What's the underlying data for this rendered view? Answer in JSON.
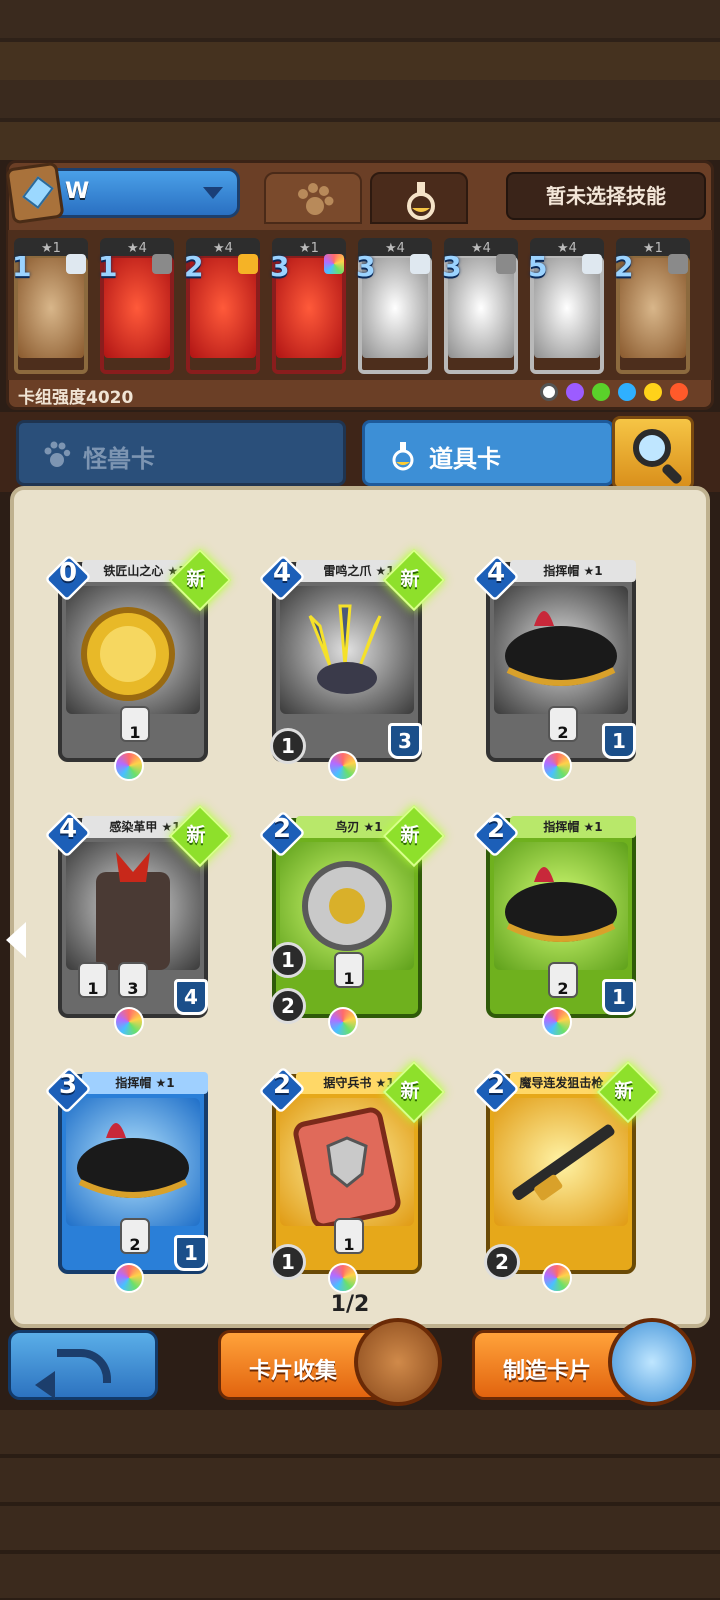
{
  "header": {
    "deck_name": "W",
    "skill_label": "暂未选择技能",
    "tabs": [
      "paw-icon",
      "flask-icon"
    ]
  },
  "deck": {
    "power_label": "卡组强度4020",
    "cards": [
      {
        "stars": "★1",
        "cost": "1",
        "style": "gold"
      },
      {
        "stars": "★4",
        "cost": "1",
        "style": "red"
      },
      {
        "stars": "★4",
        "cost": "2",
        "style": "red"
      },
      {
        "stars": "★1",
        "cost": "3",
        "style": "red"
      },
      {
        "stars": "★4",
        "cost": "3",
        "style": "gray"
      },
      {
        "stars": "★4",
        "cost": "3",
        "style": "gray"
      },
      {
        "stars": "★4",
        "cost": "5",
        "style": "gray"
      },
      {
        "stars": "★1",
        "cost": "2",
        "style": "gold"
      }
    ],
    "elements": [
      "white",
      "purple",
      "green",
      "blue",
      "yellow",
      "red"
    ]
  },
  "category_tabs": {
    "monster": "怪兽卡",
    "item": "道具卡"
  },
  "grid": {
    "new_label": "新",
    "cards": [
      {
        "name": "铁匠山之心 ★1",
        "cost": "0",
        "new": true,
        "color": "gray"
      },
      {
        "name": "雷鸣之爪 ★1",
        "cost": "4",
        "new": true,
        "color": "gray"
      },
      {
        "name": "指挥帽 ★1",
        "cost": "4",
        "new": false,
        "color": "gray"
      },
      {
        "name": "感染革甲 ★1",
        "cost": "4",
        "new": true,
        "color": "gray"
      },
      {
        "name": "鸟刃 ★1",
        "cost": "2",
        "new": true,
        "color": "green"
      },
      {
        "name": "指挥帽 ★1",
        "cost": "2",
        "new": false,
        "color": "green"
      },
      {
        "name": "指挥帽 ★1",
        "cost": "3",
        "new": false,
        "color": "blue"
      },
      {
        "name": "据守兵书 ★1",
        "cost": "2",
        "new": true,
        "color": "yellow"
      },
      {
        "name": "魔导连发狙击枪 ★1",
        "cost": "2",
        "new": true,
        "color": "yellow"
      }
    ],
    "stats": {
      "c0": [
        "1"
      ],
      "c1": [
        "1",
        "3"
      ],
      "c2": [
        "2",
        "1"
      ],
      "c3": [
        "1",
        "3",
        "4"
      ],
      "c4": [
        "1",
        "2",
        "1"
      ],
      "c5": [
        "2",
        "1"
      ],
      "c6": [
        "2",
        "1"
      ],
      "c7": [
        "1",
        "1"
      ],
      "c8": [
        "2"
      ]
    }
  },
  "pagination": "1/2",
  "bottom": {
    "collect_label": "卡片收集",
    "craft_label": "制造卡片"
  }
}
